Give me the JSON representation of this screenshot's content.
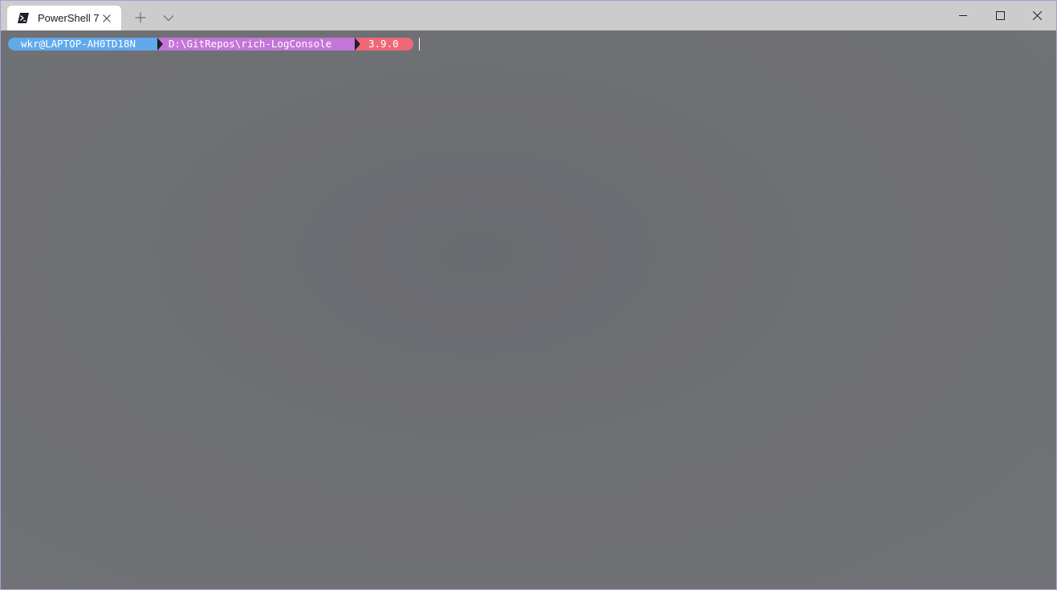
{
  "window": {
    "accent_color": "#a79fd6"
  },
  "tabbar": {
    "active_tab": {
      "title": "PowerShell 7",
      "icon": "powershell-icon",
      "close_icon": "close-icon"
    },
    "new_tab_icon": "plus-icon",
    "dropdown_icon": "chevron-down-icon"
  },
  "caption_buttons": {
    "minimize_icon": "minimize-icon",
    "maximize_icon": "maximize-icon",
    "close_icon": "close-icon"
  },
  "terminal": {
    "background_color": "#6f7074",
    "prompt": {
      "user_host": "wkr@LAPTOP-AH0TD18N",
      "user_host_color": "#61a9ec",
      "path": "D:\\GitRepos\\rich-LogConsole",
      "path_color": "#c475d8",
      "version": "3.9.0",
      "version_color": "#f0677a"
    }
  }
}
